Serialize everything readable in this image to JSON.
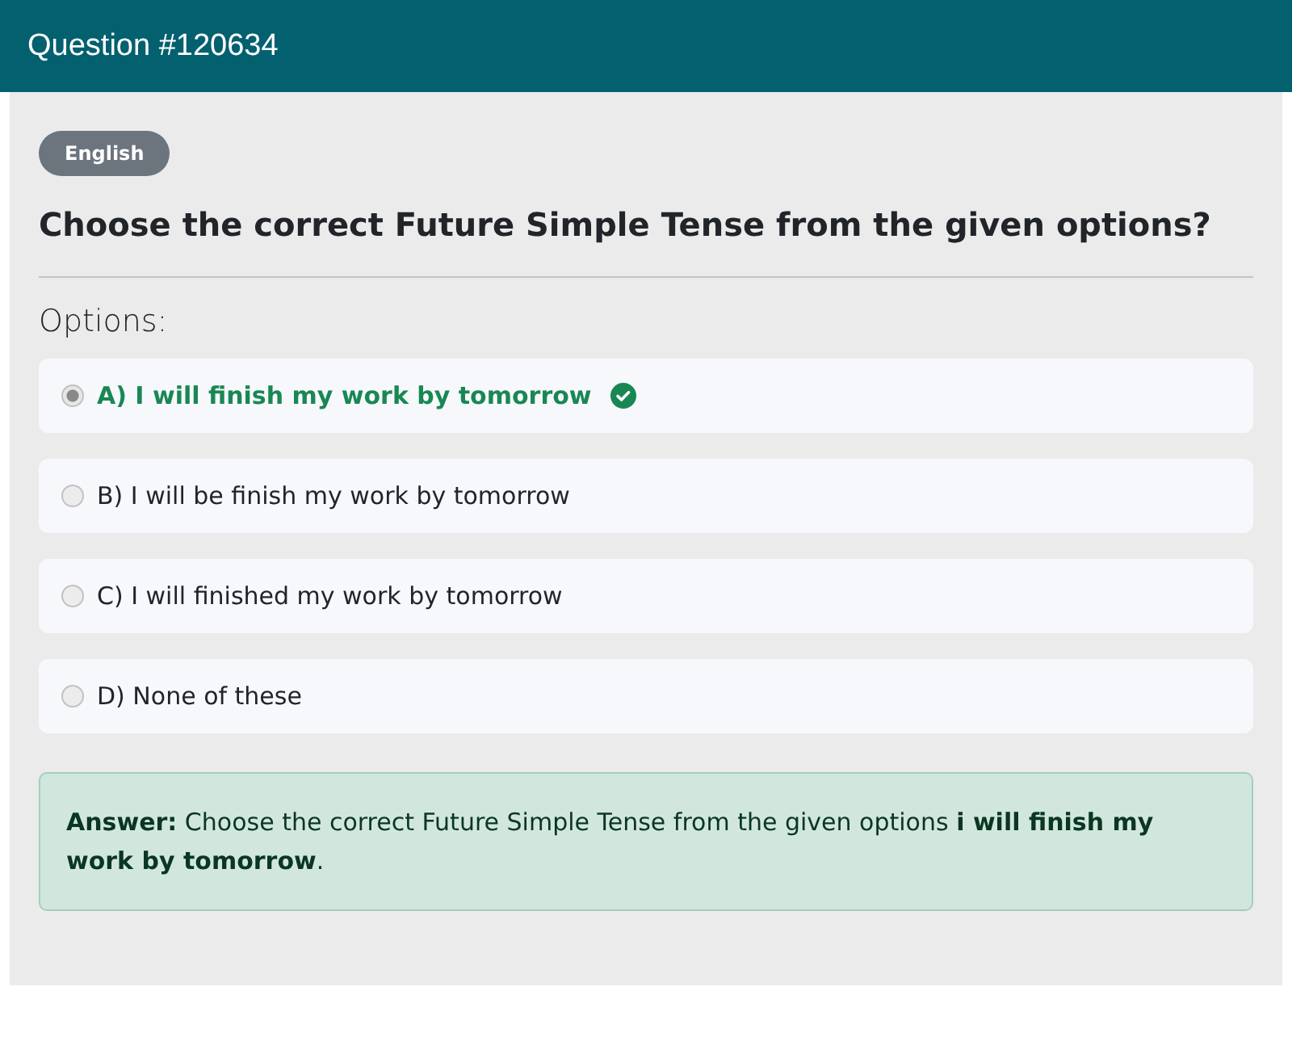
{
  "header": {
    "title": "Question #120634"
  },
  "subject_badge": "English",
  "question": "Choose the correct Future Simple Tense from the given options?",
  "options_label": "Options:",
  "options": [
    {
      "text": "A) I will finish my work by tomorrow",
      "selected": true,
      "correct": true
    },
    {
      "text": "B) I will be finish my work by tomorrow",
      "selected": false,
      "correct": false
    },
    {
      "text": "C) I will finished my work by tomorrow",
      "selected": false,
      "correct": false
    },
    {
      "text": "D) None of these",
      "selected": false,
      "correct": false
    }
  ],
  "answer": "**Answer:** Choose the correct Future Simple Tense from the given options **i will finish my work by tomorrow**."
}
